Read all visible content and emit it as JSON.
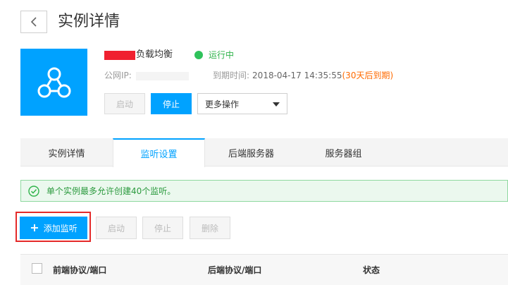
{
  "header": {
    "back_icon": "chevron-left-icon",
    "title": "实例详情"
  },
  "instance": {
    "logo_icon": "load-balancer-network-icon",
    "logo_color": "#00a2ff",
    "name_suffix": "负载均衡",
    "status": "运行中",
    "status_color": "#2fc25b",
    "ip_label": "公网IP:",
    "expire_label": "到期时间:",
    "expire_value": "2018-04-17 14:35:55",
    "expire_warning": "(30天后到期)"
  },
  "actions": {
    "start_label": "启动",
    "stop_label": "停止",
    "more_label": "更多操作"
  },
  "tabs": [
    {
      "label": "实例详情"
    },
    {
      "label": "监听设置"
    },
    {
      "label": "后端服务器"
    },
    {
      "label": "服务器组"
    }
  ],
  "notice": {
    "icon": "check-circle-icon",
    "text": "单个实例最多允许创建40个监听。"
  },
  "listener_actions": {
    "add_label": "添加监听",
    "start_label": "启动",
    "stop_label": "停止",
    "delete_label": "删除"
  },
  "table": {
    "columns": [
      "前端协议/端口",
      "后端协议/端口",
      "状态"
    ]
  }
}
